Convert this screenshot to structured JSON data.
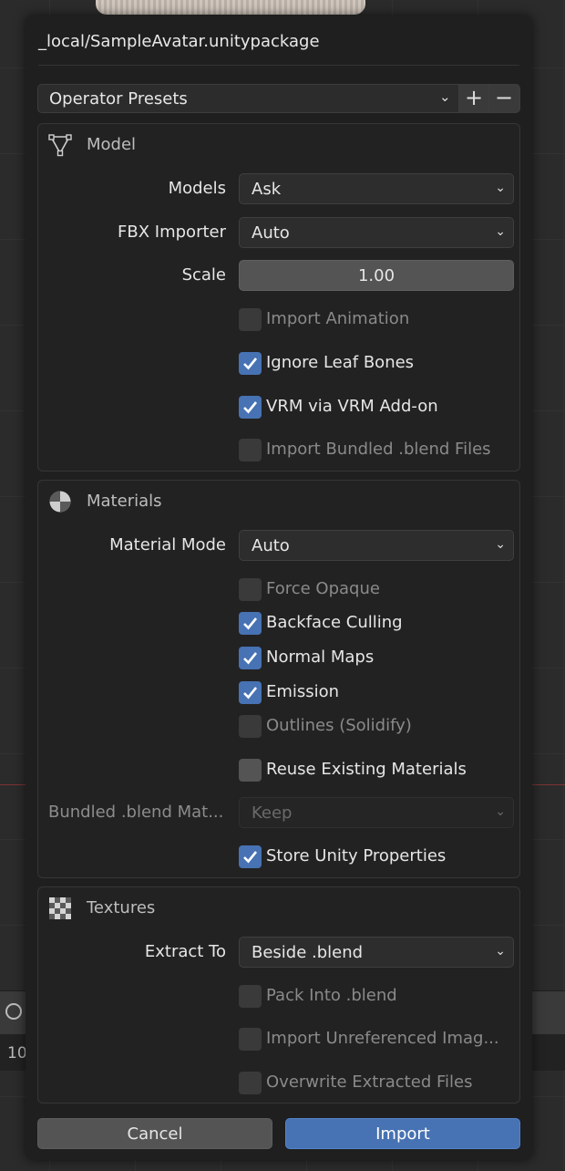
{
  "dialog": {
    "title": "_local/SampleAvatar.unitypackage",
    "presets": {
      "label": "Operator Presets",
      "add": "+",
      "remove": "−"
    }
  },
  "model": {
    "title": "Model",
    "icon": "mesh-vertex-icon",
    "models": {
      "label": "Models",
      "value": "Ask"
    },
    "fbx_importer": {
      "label": "FBX Importer",
      "value": "Auto"
    },
    "scale": {
      "label": "Scale",
      "value": "1.00"
    },
    "import_animation": {
      "label": "Import Animation",
      "checked": false,
      "enabled": false
    },
    "ignore_leaf_bones": {
      "label": "Ignore Leaf Bones",
      "checked": true,
      "enabled": true
    },
    "vrm_via_addon": {
      "label": "VRM via VRM Add-on",
      "checked": true,
      "enabled": true
    },
    "import_bundled_blend": {
      "label": "Import Bundled .blend Files",
      "checked": false,
      "enabled": false
    }
  },
  "materials": {
    "title": "Materials",
    "icon": "material-sphere-icon",
    "material_mode": {
      "label": "Material Mode",
      "value": "Auto"
    },
    "force_opaque": {
      "label": "Force Opaque",
      "checked": false,
      "enabled": false
    },
    "backface_culling": {
      "label": "Backface Culling",
      "checked": true,
      "enabled": true
    },
    "normal_maps": {
      "label": "Normal Maps",
      "checked": true,
      "enabled": true
    },
    "emission": {
      "label": "Emission",
      "checked": true,
      "enabled": true
    },
    "outlines": {
      "label": "Outlines (Solidify)",
      "checked": false,
      "enabled": false
    },
    "reuse_materials": {
      "label": "Reuse Existing Materials",
      "checked": false,
      "enabled": true
    },
    "bundled_blend_mat": {
      "label": "Bundled .blend Mat...",
      "value": "Keep",
      "enabled": false
    },
    "store_unity_props": {
      "label": "Store Unity Properties",
      "checked": true,
      "enabled": true
    }
  },
  "textures": {
    "title": "Textures",
    "icon": "checker-texture-icon",
    "extract_to": {
      "label": "Extract To",
      "value": "Beside .blend"
    },
    "pack_into_blend": {
      "label": "Pack Into .blend",
      "checked": false,
      "enabled": false
    },
    "import_unreferenced": {
      "label": "Import Unreferenced Imag...",
      "checked": false,
      "enabled": false
    },
    "overwrite_extracted": {
      "label": "Overwrite Extracted Files",
      "checked": false,
      "enabled": false
    }
  },
  "buttons": {
    "cancel": "Cancel",
    "import": "Import"
  },
  "background": {
    "row_number": "10"
  },
  "colors": {
    "accent": "#4772b3",
    "panel": "#1f1f1f",
    "field": "#2d2d2d"
  }
}
